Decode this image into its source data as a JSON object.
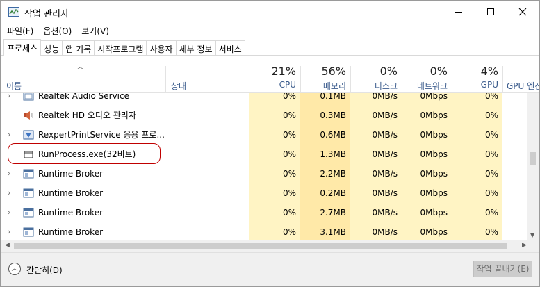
{
  "window": {
    "title": "작업 관리자"
  },
  "menu": [
    "파일(F)",
    "옵션(O)",
    "보기(V)"
  ],
  "tabs": [
    "프로세스",
    "성능",
    "앱 기록",
    "시작프로그램",
    "사용자",
    "세부 정보",
    "서비스"
  ],
  "active_tab": "프로세스",
  "columns": {
    "name": "이름",
    "status": "상태",
    "cpu": {
      "pct": "21%",
      "label": "CPU"
    },
    "memory": {
      "pct": "56%",
      "label": "메모리"
    },
    "disk": {
      "pct": "0%",
      "label": "디스크"
    },
    "network": {
      "pct": "0%",
      "label": "네트워크"
    },
    "gpu": {
      "pct": "4%",
      "label": "GPU"
    },
    "gpu_engine": {
      "label": "GPU 엔진"
    }
  },
  "processes": [
    {
      "name": "Realtek Audio Service",
      "cpu": "0%",
      "memory": "0.1MB",
      "disk": "0MB/s",
      "network": "0Mbps",
      "gpu": "0%",
      "expandable": true,
      "icon": "service-icon"
    },
    {
      "name": "Realtek HD 오디오 관리자",
      "cpu": "0%",
      "memory": "0.3MB",
      "disk": "0MB/s",
      "network": "0Mbps",
      "gpu": "0%",
      "expandable": false,
      "icon": "speaker-icon"
    },
    {
      "name": "RexpertPrintService 응용 프로...",
      "cpu": "0%",
      "memory": "0.6MB",
      "disk": "0MB/s",
      "network": "0Mbps",
      "gpu": "0%",
      "expandable": true,
      "icon": "printer-app-icon"
    },
    {
      "name": "RunProcess.exe(32비트)",
      "cpu": "0%",
      "memory": "1.3MB",
      "disk": "0MB/s",
      "network": "0Mbps",
      "gpu": "0%",
      "expandable": false,
      "icon": "process-icon"
    },
    {
      "name": "Runtime Broker",
      "cpu": "0%",
      "memory": "2.2MB",
      "disk": "0MB/s",
      "network": "0Mbps",
      "gpu": "0%",
      "expandable": true,
      "icon": "window-app-icon"
    },
    {
      "name": "Runtime Broker",
      "cpu": "0%",
      "memory": "0.2MB",
      "disk": "0MB/s",
      "network": "0Mbps",
      "gpu": "0%",
      "expandable": true,
      "icon": "window-app-icon"
    },
    {
      "name": "Runtime Broker",
      "cpu": "0%",
      "memory": "2.7MB",
      "disk": "0MB/s",
      "network": "0Mbps",
      "gpu": "0%",
      "expandable": true,
      "icon": "window-app-icon"
    },
    {
      "name": "Runtime Broker",
      "cpu": "0%",
      "memory": "3.1MB",
      "disk": "0MB/s",
      "network": "0Mbps",
      "gpu": "0%",
      "expandable": true,
      "icon": "window-app-icon"
    }
  ],
  "footer": {
    "fewer_details": "간단히(D)",
    "end_task": "작업 끝내기(E)"
  },
  "colors": {
    "cpu_col_bg": "#fff4c4",
    "mem_col_bg": "#ffe9a8",
    "highlight": "#c00000",
    "header_label": "#3a5b8c"
  }
}
